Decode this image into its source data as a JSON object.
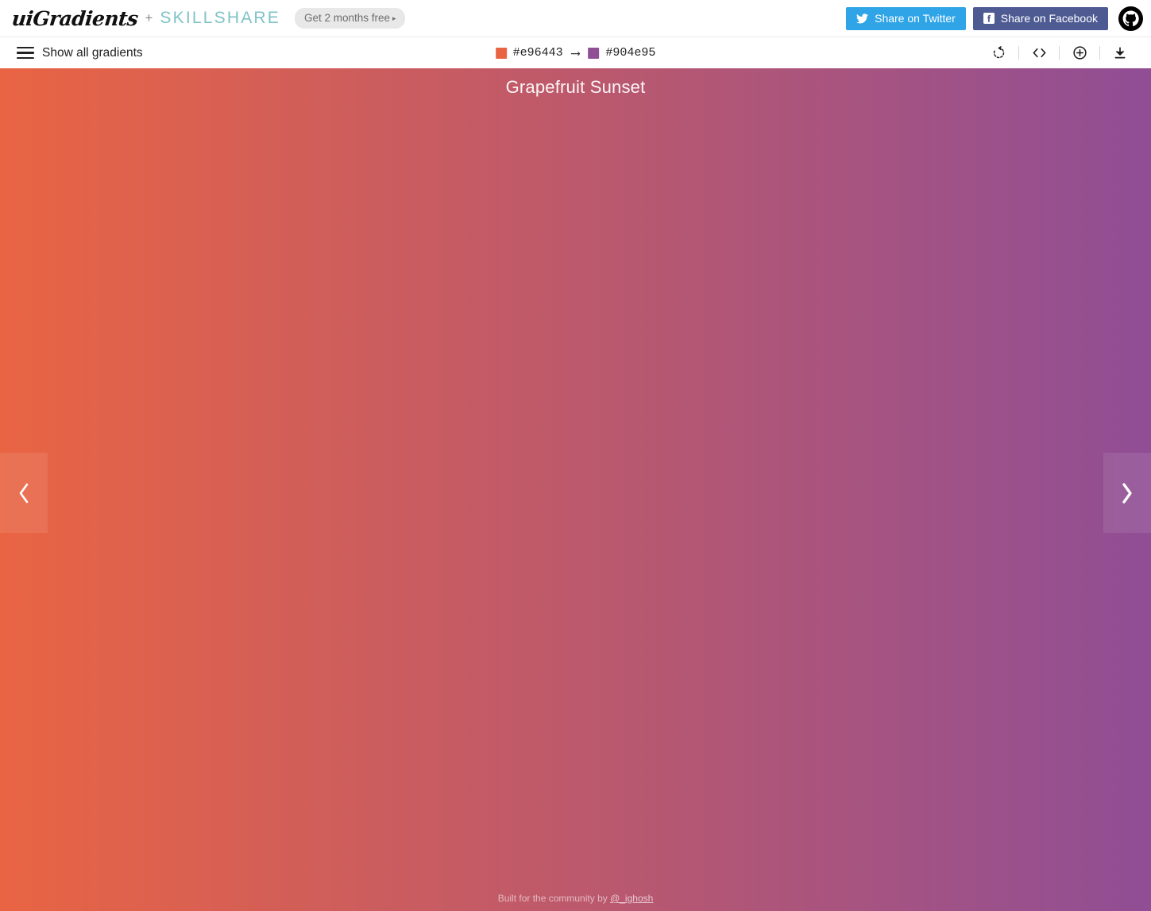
{
  "header": {
    "logo_text": "uiGradients",
    "plus": "+",
    "partner": "SKILLSHARE",
    "promo_label": "Get 2 months free",
    "promo_caret": "▸",
    "share_twitter_label": "Share on Twitter",
    "share_facebook_label": "Share on Facebook",
    "twitter_color": "#2fa4e7",
    "facebook_color": "#4e5b93",
    "github_icon": "github-icon"
  },
  "toolbar": {
    "show_all_label": "Show all gradients",
    "menu_icon": "hamburger-icon",
    "color_start": "#e96443",
    "color_end": "#904e95",
    "arrow": "⟶",
    "icons": [
      {
        "name": "rotate-icon",
        "title": "Rotate gradient"
      },
      {
        "name": "code-icon",
        "title": "Get CSS code"
      },
      {
        "name": "plus-circle-icon",
        "title": "Add gradient"
      },
      {
        "name": "download-icon",
        "title": "Download"
      }
    ]
  },
  "stage": {
    "gradient_name": "Grapefruit Sunset",
    "gradient_css": "linear-gradient(to right, #e96443 0%, #904e95 100%)",
    "prev_label": "Previous gradient",
    "next_label": "Next gradient"
  },
  "footer": {
    "text_prefix": "Built for the community by ",
    "author_handle": "@_ighosh"
  }
}
